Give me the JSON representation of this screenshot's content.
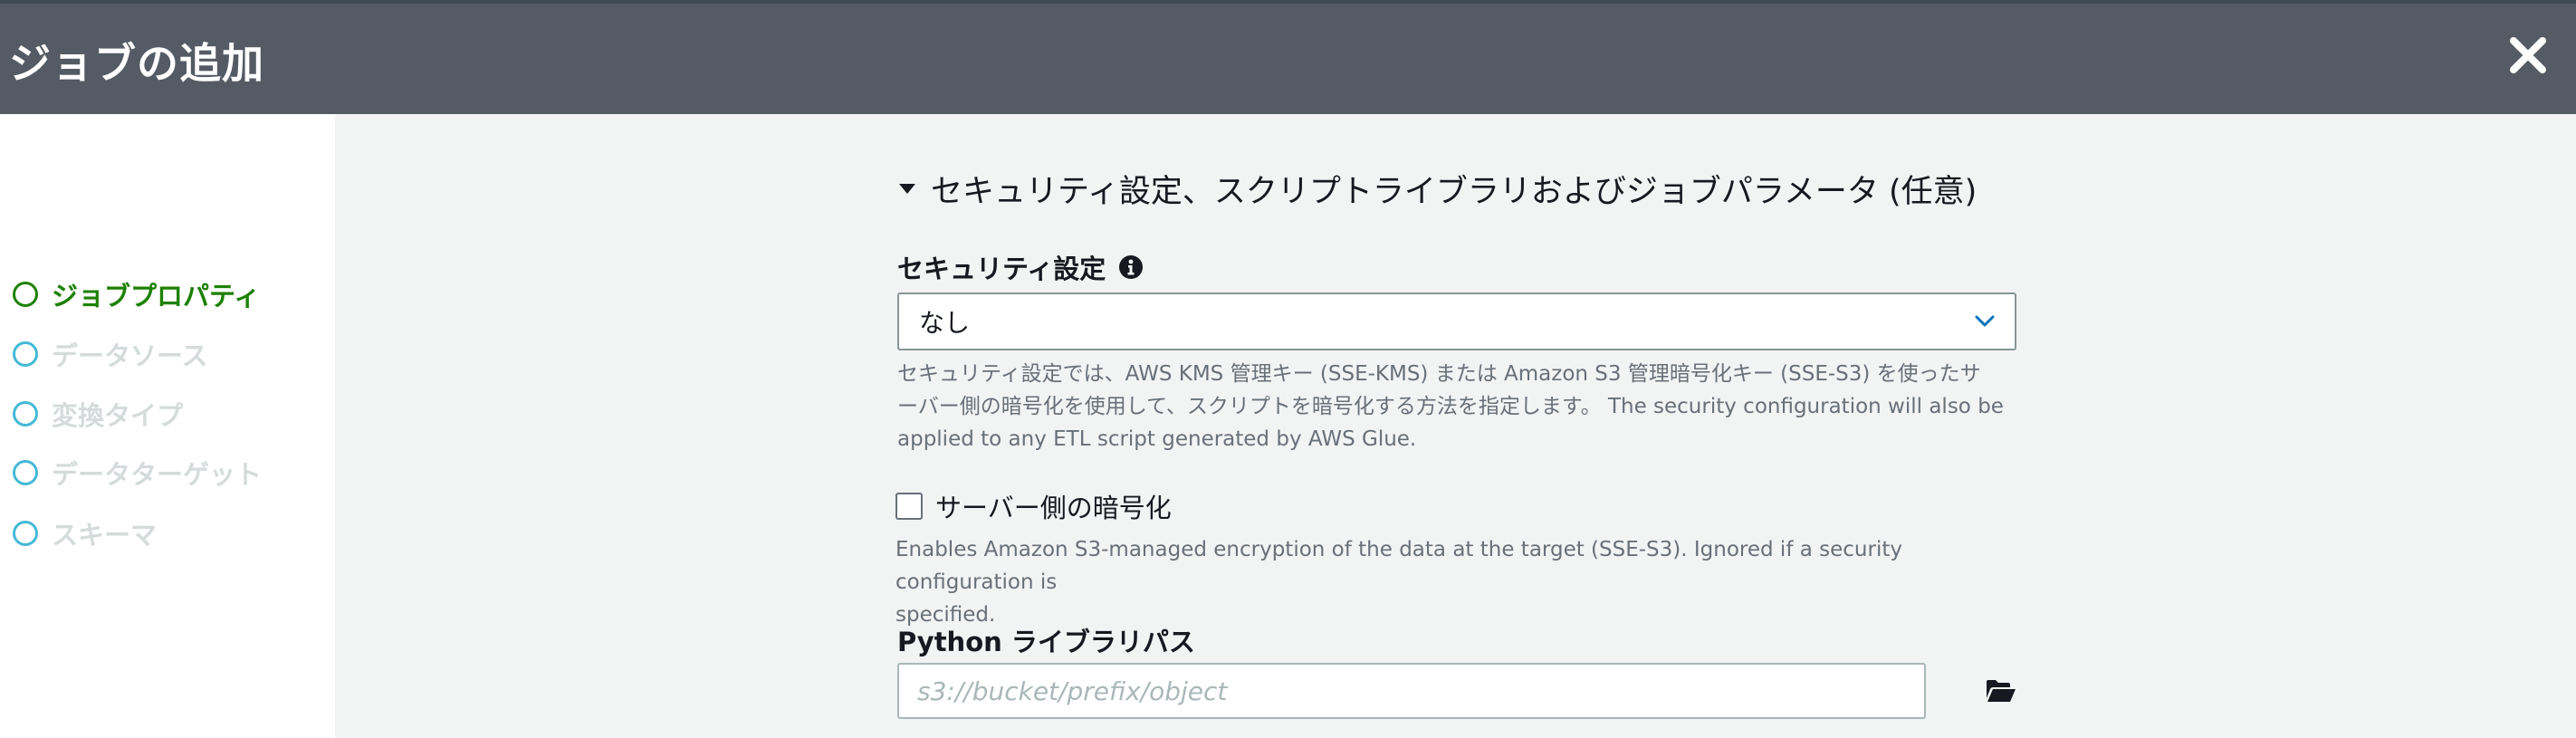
{
  "header": {
    "title": "ジョブの追加",
    "close_icon": "close-icon"
  },
  "sidebar": {
    "steps": [
      {
        "label": "ジョブプロパティ",
        "state": "active"
      },
      {
        "label": "データソース",
        "state": "inactive"
      },
      {
        "label": "変換タイプ",
        "state": "inactive"
      },
      {
        "label": "データターゲット",
        "state": "inactive"
      },
      {
        "label": "スキーマ",
        "state": "inactive"
      }
    ]
  },
  "section": {
    "title": "セキュリティ設定、スクリプトライブラリおよびジョブパラメータ (任意)",
    "expanded": true
  },
  "security_config": {
    "label": "セキュリティ設定",
    "selected": "なし",
    "description_line1": "セキュリティ設定では、AWS KMS 管理キー (SSE-KMS) または Amazon S3 管理暗号化キー (SSE-S3) を使ったサ",
    "description_line2": "ーバー側の暗号化を使用して、スクリプトを暗号化する方法を指定します。 The security configuration will also be",
    "description_line3": "applied to any ETL script generated by AWS Glue."
  },
  "server_side_encryption": {
    "label": "サーバー側の暗号化",
    "checked": false,
    "description_line1": "Enables Amazon S3-managed encryption of the data at the target (SSE-S3). Ignored if a security configuration is",
    "description_line2": "specified."
  },
  "python_library": {
    "label": "Python ライブラリパス",
    "placeholder": "s3://bucket/prefix/object",
    "value": ""
  },
  "colors": {
    "header_bg": "#545b64",
    "active_step": "#1d8102",
    "inactive_step_circle": "#44b9d6",
    "inactive_step_text": "#d5dbdb",
    "page_bg": "#f2f3f3",
    "link_blue": "#0073bb"
  }
}
